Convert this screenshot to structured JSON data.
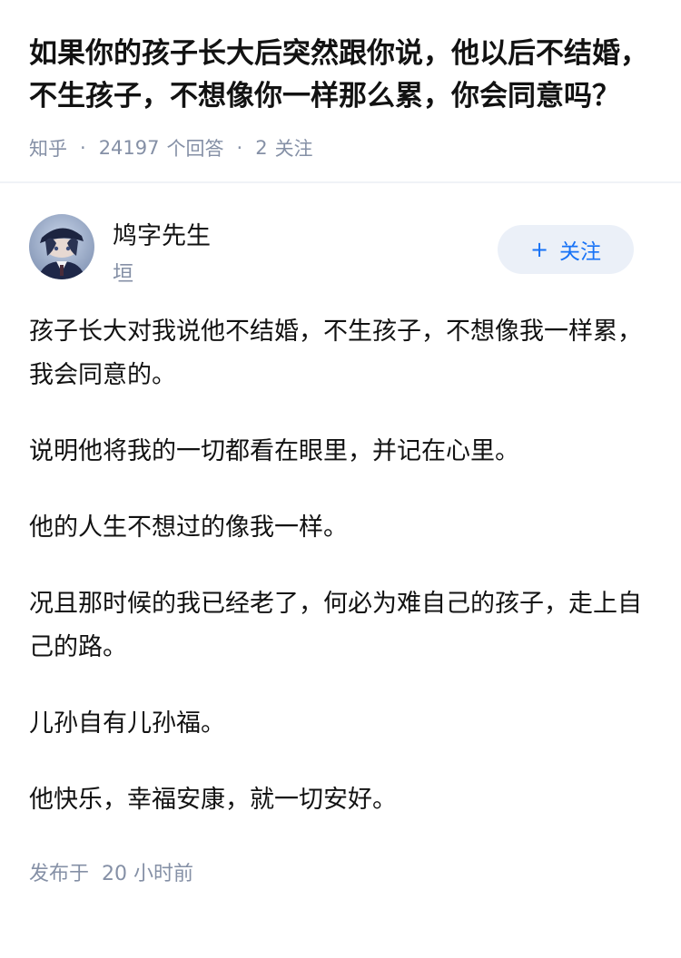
{
  "question": {
    "title": "如果你的孩子长大后突然跟你说，他以后不结婚，不生孩子，不想像你一样那么累，你会同意吗？",
    "meta": {
      "source": "知乎",
      "answer_count": "24197",
      "answer_label": "个回答",
      "follow_count": "2",
      "follow_label": "关注",
      "separator": "·"
    }
  },
  "author": {
    "name": "鸠字先生",
    "headline": "垣",
    "follow_button": "关注",
    "follow_plus": "+"
  },
  "answer": {
    "paragraphs": [
      "孩子长大对我说他不结婚，不生孩子，不想像我一样累，我会同意的。",
      "说明他将我的一切都看在眼里，并记在心里。",
      "他的人生不想过的像我一样。",
      "况且那时候的我已经老了，何必为难自己的孩子，走上自己的路。",
      "儿孙自有儿孙福。",
      "他快乐，幸福安康，就一切安好。"
    ],
    "published_label": "发布于",
    "published_time": "20 小时前"
  },
  "colors": {
    "text": "#121212",
    "meta": "#8590a6",
    "accent": "#1772f6",
    "follow_bg": "#ebf0f8",
    "divider": "#f0f2f7"
  }
}
